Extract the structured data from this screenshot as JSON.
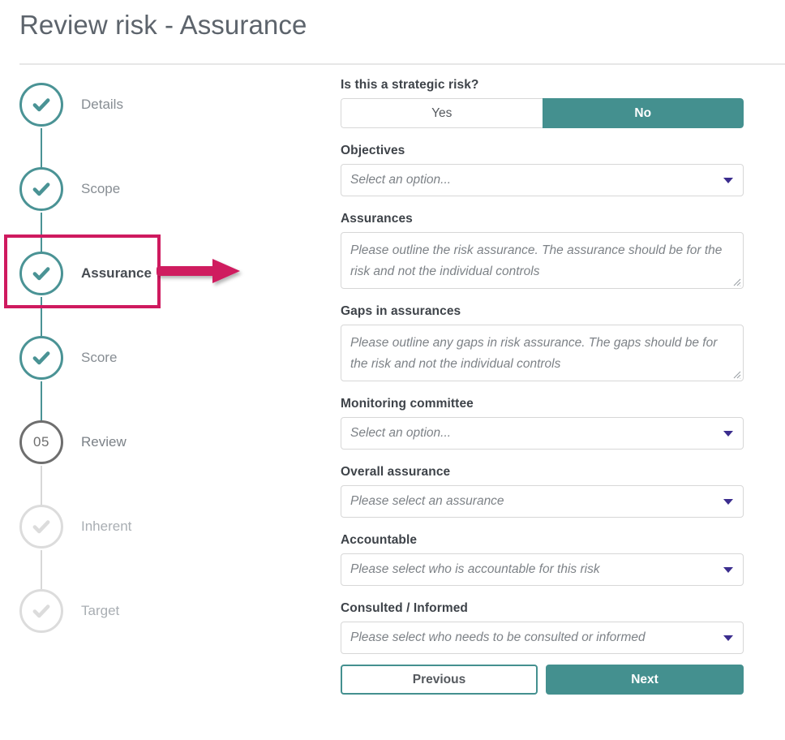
{
  "page": {
    "title": "Review risk - Assurance"
  },
  "stepper": {
    "steps": [
      {
        "label": "Details",
        "state": "done",
        "icon": "check-icon",
        "number": ""
      },
      {
        "label": "Scope",
        "state": "done",
        "icon": "check-icon",
        "number": ""
      },
      {
        "label": "Assurance",
        "state": "done",
        "icon": "check-icon",
        "number": "",
        "highlighted": true
      },
      {
        "label": "Score",
        "state": "done",
        "icon": "check-icon",
        "number": ""
      },
      {
        "label": "Review",
        "state": "current",
        "icon": "",
        "number": "05"
      },
      {
        "label": "Inherent",
        "state": "todo",
        "icon": "check-icon",
        "number": ""
      },
      {
        "label": "Target",
        "state": "todo",
        "icon": "check-icon",
        "number": ""
      }
    ]
  },
  "annotation": {
    "highlight_color": "#cf1a5f",
    "arrow_color": "#cf1a5f",
    "target": "Assurance"
  },
  "form": {
    "strategic_risk": {
      "label": "Is this a strategic risk?",
      "options": [
        "Yes",
        "No"
      ],
      "selected": "No"
    },
    "objectives": {
      "label": "Objectives",
      "placeholder": "Select an option..."
    },
    "assurances": {
      "label": "Assurances",
      "placeholder": "Please outline the risk assurance. The assurance should be for the risk and not the individual controls"
    },
    "gaps_in_assurances": {
      "label": "Gaps in assurances",
      "placeholder": "Please outline any gaps in risk assurance. The gaps should be for the risk and not the individual controls"
    },
    "monitoring_committee": {
      "label": "Monitoring committee",
      "placeholder": "Select an option..."
    },
    "overall_assurance": {
      "label": "Overall assurance",
      "placeholder": "Please select an assurance"
    },
    "accountable": {
      "label": "Accountable",
      "placeholder": "Please select who is accountable for this risk"
    },
    "consulted_informed": {
      "label": "Consulted / Informed",
      "placeholder": "Please select who needs to be consulted or informed"
    },
    "actions": {
      "previous_label": "Previous",
      "next_label": "Next"
    }
  },
  "theme": {
    "accent": "#44908f",
    "highlight": "#cf1a5f",
    "caret": "#3b2d8e",
    "label_text": "#3e4349",
    "muted_text": "#8b9096"
  }
}
